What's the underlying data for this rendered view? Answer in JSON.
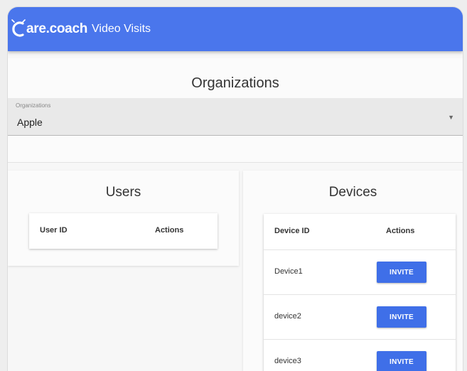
{
  "app": {
    "brand_name": "are.coach",
    "brand_sub": "Video Visits"
  },
  "organizations": {
    "title": "Organizations",
    "select_label": "Organizations",
    "selected": "Apple"
  },
  "users": {
    "title": "Users",
    "columns": [
      "User ID",
      "Actions"
    ]
  },
  "devices": {
    "title": "Devices",
    "columns": [
      "Device ID",
      "Actions"
    ],
    "rows": [
      {
        "id": "Device1",
        "action": "INVITE"
      },
      {
        "id": "device2",
        "action": "INVITE"
      },
      {
        "id": "device3",
        "action": "INVITE"
      }
    ]
  },
  "colors": {
    "app_bar": "#4a76ec",
    "button": "#3f6fe8"
  }
}
